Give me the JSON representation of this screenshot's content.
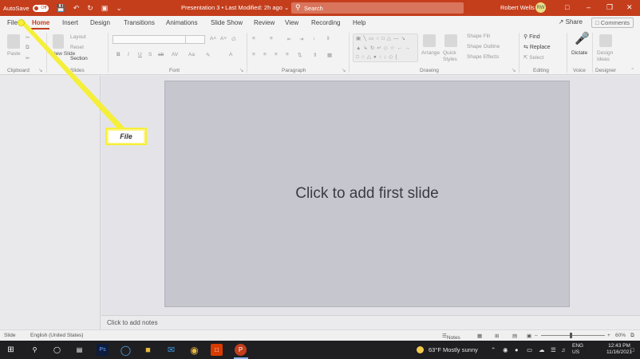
{
  "titlebar": {
    "autosave_label": "AutoSave",
    "autosave_state": "Off",
    "doc_title": "Presentation 3  •  Last Modified: 2h ago  ⌄",
    "search_placeholder": "Search",
    "user_name": "Robert Wells",
    "user_initials": "RW"
  },
  "tabs": [
    "File",
    "Home",
    "Insert",
    "Design",
    "Transitions",
    "Animations",
    "Slide Show",
    "Review",
    "View",
    "Recording",
    "Help"
  ],
  "active_tab": "Home",
  "share_label": "Share",
  "comments_label": "Comments",
  "ribbon": {
    "groups": [
      "Clipboard",
      "Slides",
      "Font",
      "Paragraph",
      "Drawing",
      "Editing",
      "Voice",
      "Designer"
    ],
    "paste": "Paste",
    "new_slide": "New Slide",
    "layout": "Layout",
    "reset": "Reset",
    "section": "Section",
    "arrange": "Arrange",
    "quick_styles": "Quick Styles",
    "shape_fill": "Shape Fill",
    "shape_outline": "Shape Outline",
    "shape_effects": "Shape Effects",
    "find": "Find",
    "replace": "Replace",
    "select": "Select",
    "dictate": "Dictate",
    "design_ideas": "Design Ideas"
  },
  "slide": {
    "placeholder": "Click to add first slide"
  },
  "notes_placeholder": "Click to add notes",
  "statusbar": {
    "view": "Slide",
    "language": "English (United States)",
    "notes": "Notes",
    "zoom": "60%"
  },
  "taskbar": {
    "weather": "63°F  Mostly sunny",
    "lang1": "ENG",
    "lang2": "US",
    "time": "12:43 PM",
    "date": "11/16/2021"
  },
  "callout": {
    "label": "File"
  },
  "colors": {
    "accent": "#c43e1c",
    "callout": "#f5ef3a",
    "slide_bg": "#c6c6cf"
  }
}
